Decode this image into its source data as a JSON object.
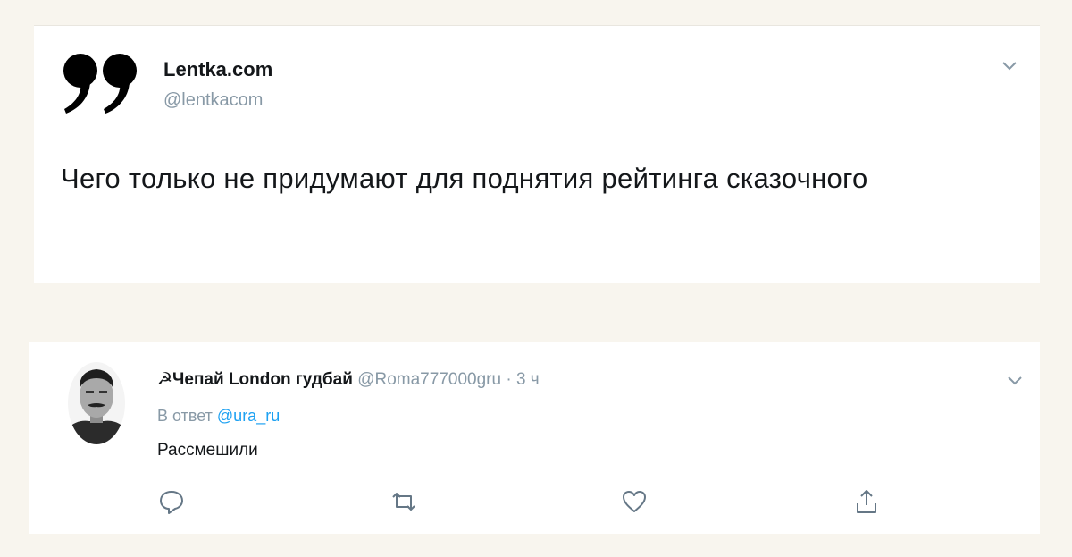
{
  "tweet": {
    "author_name": "Lentka.com",
    "author_handle": "@lentkacom",
    "text": "Чего только не придумают для поднятия рейтинга сказочного"
  },
  "reply": {
    "author_name": "☭Чепай London гудбай",
    "author_handle": "@Roma777000gru",
    "separator": " · ",
    "time": "3 ч",
    "reply_prefix": "В ответ",
    "reply_to": "@ura_ru",
    "text": "Рассмешили"
  },
  "icons": {
    "menu": "chevron-down-icon",
    "actions": [
      "reply-icon",
      "retweet-icon",
      "like-icon",
      "share-icon"
    ]
  },
  "colors": {
    "background": "#f8f5ee",
    "text": "#14171a",
    "secondary": "#8899a6",
    "link": "#1da1f2"
  }
}
